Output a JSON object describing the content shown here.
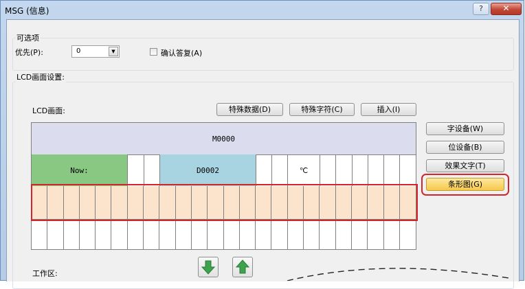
{
  "window": {
    "title": "MSG (信息)",
    "help_glyph": "?",
    "close_glyph": "✕"
  },
  "options": {
    "group_title": "可选项",
    "priority_label": "优先(P):",
    "priority_value": "0",
    "ack_label": "确认答复(A)"
  },
  "lcd_settings": {
    "group_title": "LCD画面设置:",
    "screen_label": "LCD画面:",
    "buttons": {
      "special_data": "特殊数据(D)",
      "special_char": "特殊字符(C)",
      "insert": "插入(I)"
    },
    "side_buttons": {
      "char_device": "字设备(W)",
      "bit_device": "位设备(B)",
      "effect_text": "效果文字(T)",
      "bar_graph": "条形图(G)"
    },
    "row1": {
      "text": "M0000"
    },
    "row2": {
      "now_text": "Now:",
      "device_text": "D0002",
      "unit_text": "℃"
    },
    "work_area_label": "工作区:"
  },
  "colors": {
    "row1_bg": "#dcdcef",
    "now_cell": "#88c882",
    "device_cell": "#a8d4e2",
    "bar_row": "#fbe3cc",
    "highlight": "#d3242b",
    "arrow_green": "#3fa34d"
  },
  "icons": [
    "help-icon",
    "close-icon",
    "dropdown-arrow-icon",
    "down-arrow-icon",
    "up-arrow-icon"
  ]
}
